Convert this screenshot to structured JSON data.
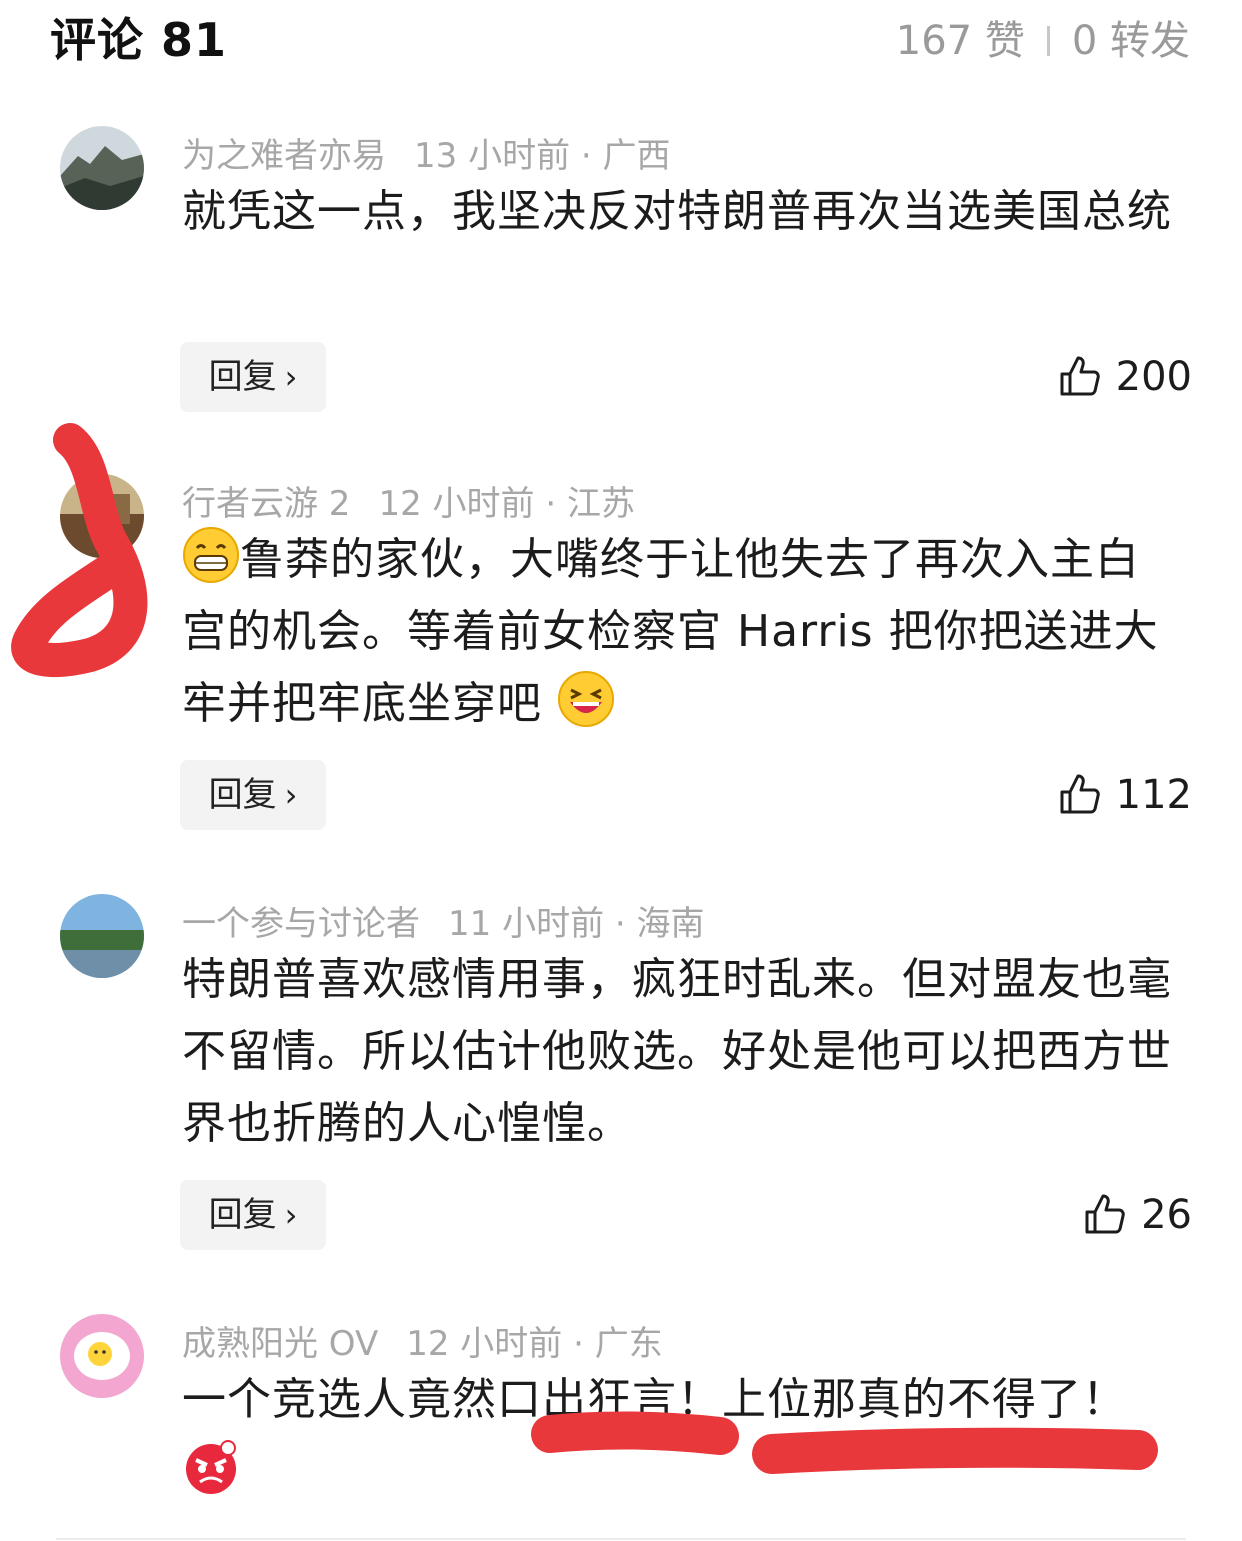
{
  "header": {
    "title": "评论 81",
    "likes": "167 赞",
    "shares": "0 转发"
  },
  "comments": [
    {
      "user": "为之难者亦易",
      "time": "13 小时前 · 广西",
      "text": "就凭这一点，我坚决反对特朗普再次当选美国总统",
      "reply": "回复",
      "likes": "200"
    },
    {
      "user": "行者云游 2",
      "time": "12 小时前 · 江苏",
      "text": "鲁莽的家伙，大嘴终于让他失去了再次入主白宫的机会。等着前女检察官 Harris 把你把送进大牢并把牢底坐穿吧",
      "reply": "回复",
      "likes": "112"
    },
    {
      "user": "一个参与讨论者",
      "time": "11 小时前 · 海南",
      "text": "特朗普喜欢感情用事，疯狂时乱来。但对盟友也毫不留情。所以估计他败选。好处是他可以把西方世界也折腾的人心惶惶。",
      "reply": "回复",
      "likes": "26"
    },
    {
      "user": "成熟阳光 OV",
      "time": "12 小时前 · 广东",
      "text": "一个竞选人竟然口出狂言！上位那真的不得了！"
    }
  ],
  "icons": {
    "like": "thumbs-up-icon",
    "chevron": "chevron-right-icon"
  },
  "colors": {
    "accent_mark": "#e8383b",
    "meta_gray": "#a7a7a7"
  }
}
